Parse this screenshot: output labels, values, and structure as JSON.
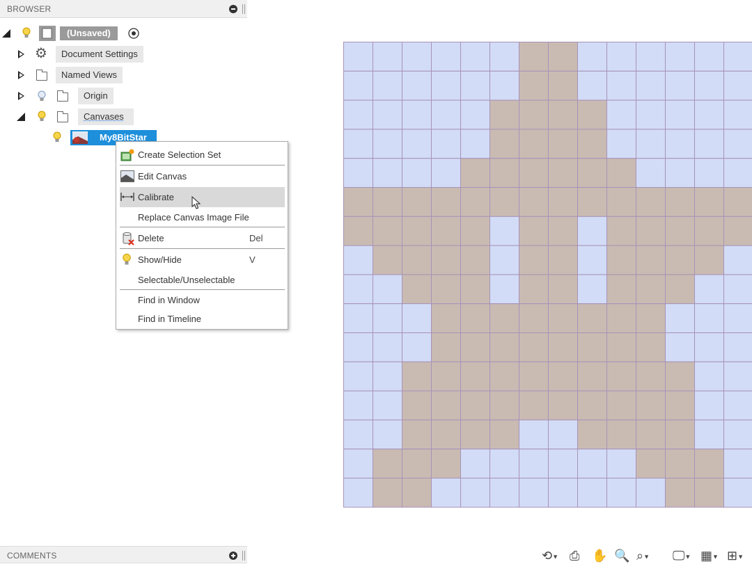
{
  "browser": {
    "title": "BROWSER",
    "root_label": "(Unsaved)",
    "items": [
      {
        "label": "Document Settings"
      },
      {
        "label": "Named Views"
      },
      {
        "label": "Origin"
      },
      {
        "label": "Canvases"
      }
    ],
    "canvas_item": "My8BitStar"
  },
  "context_menu": {
    "items": [
      {
        "label": "Create Selection Set",
        "icon": "selection-set-icon"
      },
      {
        "label": "Edit Canvas",
        "icon": "canvas-icon"
      },
      {
        "label": "Calibrate",
        "icon": "calibrate-icon",
        "highlighted": true
      },
      {
        "label": "Replace Canvas Image File"
      },
      {
        "label": "Delete",
        "shortcut": "Del",
        "icon": "delete-icon"
      },
      {
        "label": "Show/Hide",
        "shortcut": "V",
        "icon": "lightbulb-icon"
      },
      {
        "label": "Selectable/Unselectable"
      },
      {
        "label": "Find in Window"
      },
      {
        "label": "Find in Timeline"
      }
    ]
  },
  "comments": {
    "title": "COMMENTS"
  },
  "canvas_image": {
    "colors": {
      "blue": "#d2dcf6",
      "tan": "#c9bbb2",
      "line": "#a892b8"
    },
    "grid": [
      "BBBBBBTTBBBBBB",
      "BBBBBBTTBBBBBB",
      "BBBBBTTTTBBBBB",
      "BBBBBTTTTBBBBB",
      "BBBBTTTTTTBBBB",
      "TTTTTTTTTTTTTT",
      "TTTTTBTTBTTTTT",
      "BTTTTBTTBTTTTB",
      "BBTTTBTTBTTTBB",
      "BBBTTTTTTTTBBB",
      "BBBTTTTTTTTBBB",
      "BBTTTTTTTTTTBB",
      "BBTTTTTTTTTTBB",
      "BBTTTTBBTTTTBB",
      "BTTTBBBBBBTTTB",
      "BTTBBBBBBBBTTB"
    ]
  },
  "toolbar": {
    "icons": [
      "orbit-icon",
      "look-at-icon",
      "pan-icon",
      "zoom-icon",
      "fit-icon",
      "display-settings-icon",
      "grid-settings-icon",
      "viewports-icon"
    ]
  }
}
